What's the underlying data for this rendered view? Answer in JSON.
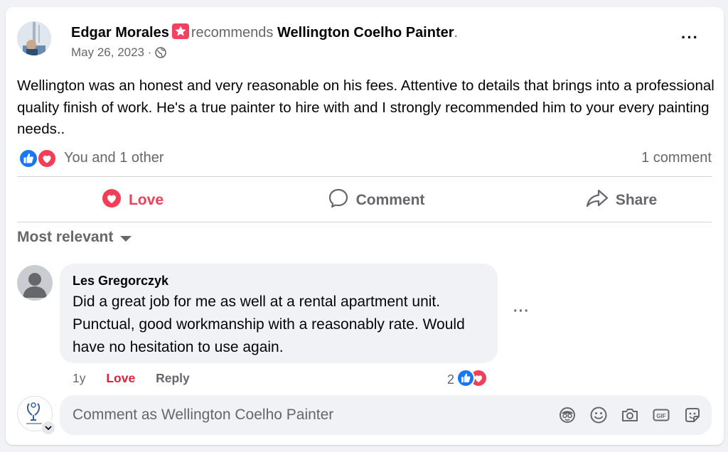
{
  "post": {
    "author": "Edgar Morales",
    "recommends_word": "recommends",
    "page": "Wellington Coelho Painter",
    "period": ".",
    "date": "May 26, 2023",
    "date_sep": "·",
    "audience_icon": "globe-icon",
    "more_icon": "···",
    "text": "Wellington was an honest and very reasonable on his fees. Attentive to details that brings into a professional quality finish of work. He's a true painter to hire with and I strongly recommended him to your every painting needs.."
  },
  "reactions": {
    "icons": [
      "like-icon",
      "love-icon"
    ],
    "text": "You and 1 other",
    "comment_count": "1 comment"
  },
  "actions": {
    "love": "Love",
    "comment": "Comment",
    "share": "Share"
  },
  "sort": {
    "label": "Most relevant"
  },
  "comment": {
    "name": "Les Gregorczyk",
    "text": "Did a great job for me as well at a rental apartment unit. Punctual, good workmanship with a reasonably rate. Would have no hesitation to use again.",
    "time": "1y",
    "love": "Love",
    "reply": "Reply",
    "reaction_count": "2",
    "more": "···"
  },
  "composer": {
    "placeholder": "Comment as Wellington Coelho Painter",
    "tools": [
      "avatar-sticker-icon",
      "emoji-icon",
      "camera-icon",
      "gif-icon",
      "sticker-icon"
    ]
  },
  "colors": {
    "love": "#f33e58",
    "like": "#1877f2",
    "secondary_text": "#65676b",
    "background": "#f0f2f5"
  }
}
